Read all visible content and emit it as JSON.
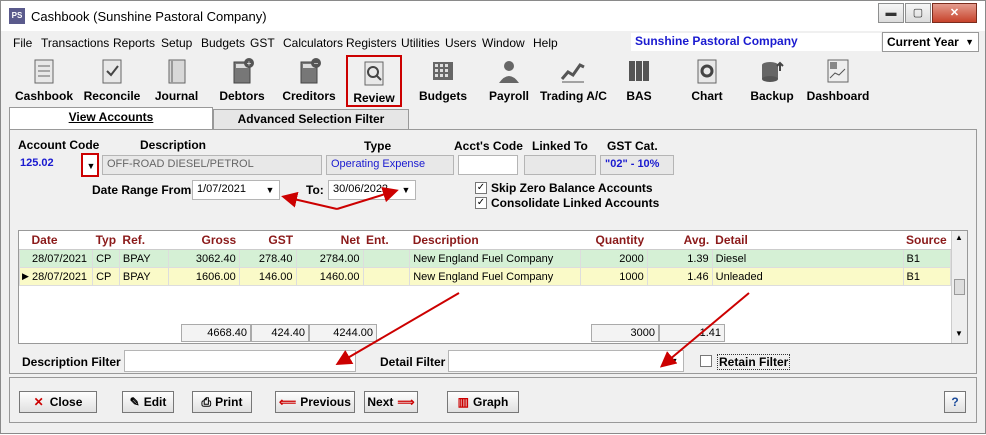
{
  "window": {
    "title": "Cashbook (Sunshine Pastoral Company)",
    "app_icon": "PS"
  },
  "menu": [
    "File",
    "Transactions",
    "Reports",
    "Setup",
    "Budgets",
    "GST",
    "Calculators",
    "Registers",
    "Utilities",
    "Users",
    "Window",
    "Help"
  ],
  "company": "Sunshine Pastoral Company",
  "period": "Current Year",
  "toolbar": [
    "Cashbook",
    "Reconcile",
    "Journal",
    "Debtors",
    "Creditors",
    "Review",
    "Budgets",
    "Payroll",
    "Trading A/C",
    "BAS",
    "Chart",
    "Backup",
    "Dashboard"
  ],
  "tabs": {
    "view": "View Accounts",
    "advanced": "Advanced Selection Filter"
  },
  "form": {
    "account_code_label": "Account Code",
    "description_label": "Description",
    "type_label": "Type",
    "accts_code_label": "Acct's Code",
    "linked_to_label": "Linked To",
    "gst_cat_label": "GST Cat.",
    "account_code": "125.02",
    "description": "OFF-ROAD DIESEL/PETROL",
    "type": "Operating Expense",
    "gst_cat": "\"02\" - 10%",
    "date_from_label": "Date Range From:",
    "date_from": "1/07/2021",
    "to_label": "To:",
    "date_to": "30/06/2022",
    "skip_zero": "Skip Zero Balance Accounts",
    "consolidate": "Consolidate Linked Accounts"
  },
  "table": {
    "headers": [
      "Date",
      "Typ",
      "Ref.",
      "Gross",
      "GST",
      "Net",
      "Ent.",
      "Description",
      "Quantity",
      "Avg.",
      "Detail",
      "Source"
    ],
    "rows": [
      [
        "28/07/2021",
        "CP",
        "BPAY",
        "3062.40",
        "278.40",
        "2784.00",
        "",
        "New England Fuel Company",
        "2000",
        "1.39",
        "Diesel",
        "B1"
      ],
      [
        "28/07/2021",
        "CP",
        "BPAY",
        "1606.00",
        "146.00",
        "1460.00",
        "",
        "New England Fuel Company",
        "1000",
        "1.46",
        "Unleaded",
        "B1"
      ]
    ],
    "totals": {
      "gross": "4668.40",
      "gst": "424.40",
      "net": "4244.00",
      "quantity": "3000",
      "avg": "1.41"
    }
  },
  "filters": {
    "description_label": "Description Filter",
    "detail_label": "Detail Filter",
    "retain": "Retain Filter"
  },
  "buttons": {
    "close": "Close",
    "edit": "Edit",
    "print": "Print",
    "previous": "Previous",
    "next": "Next",
    "graph": "Graph",
    "help": "?"
  }
}
